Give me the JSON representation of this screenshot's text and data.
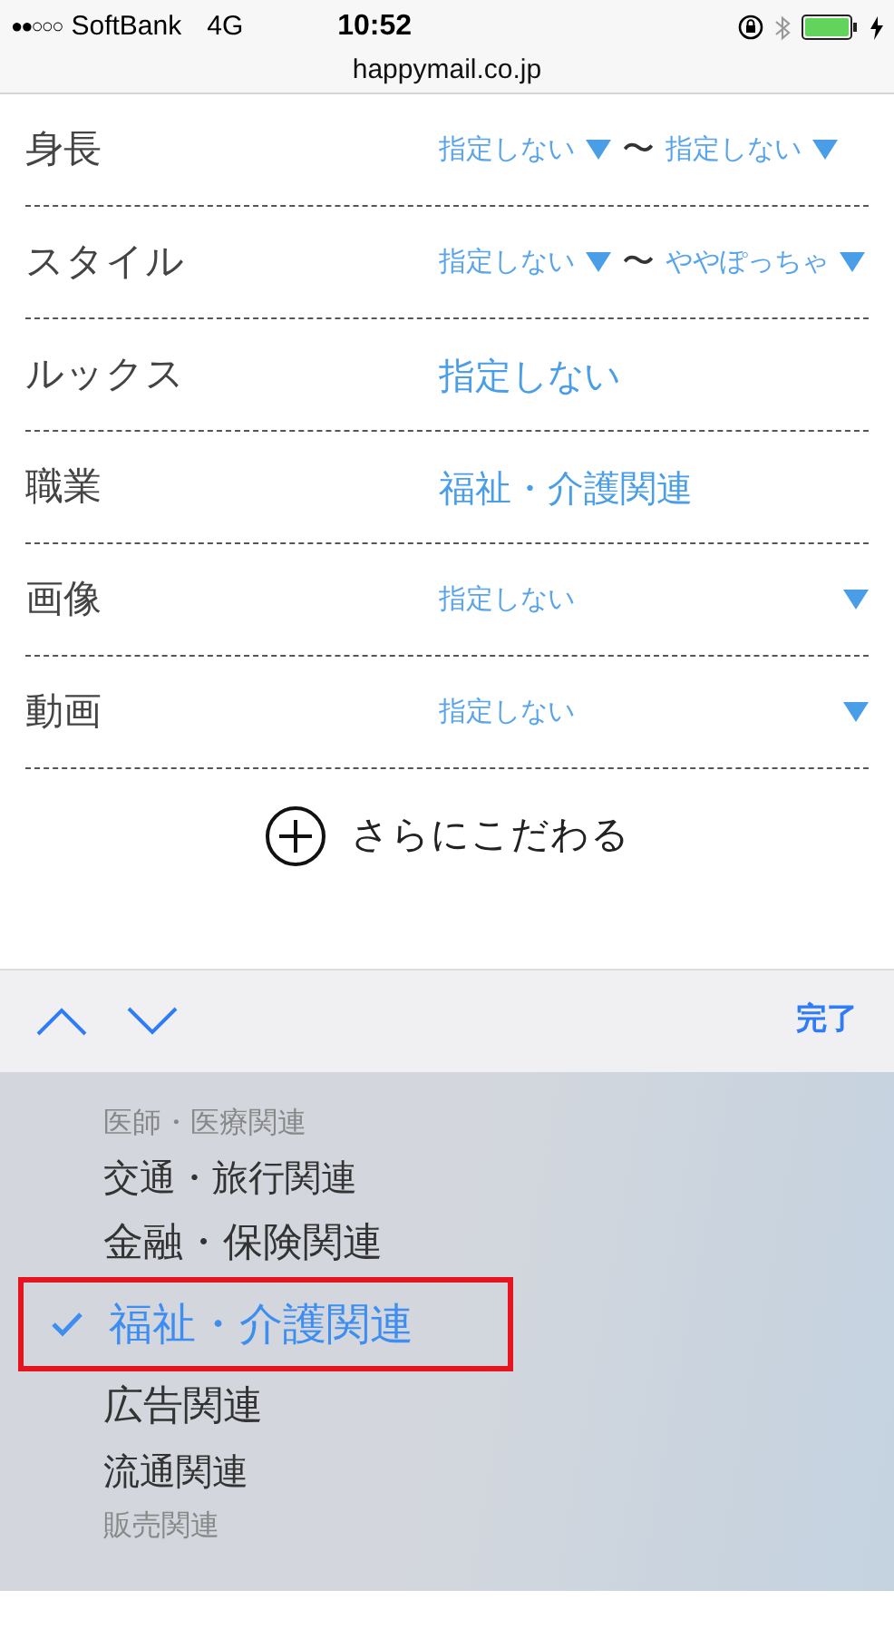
{
  "status_bar": {
    "signal_dots": "●●○○○",
    "carrier": "SoftBank",
    "network": "4G",
    "time": "10:52"
  },
  "address_bar": {
    "url": "happymail.co.jp"
  },
  "rows": [
    {
      "kind": "range",
      "label": "身長",
      "from": "指定しない",
      "separator": "〜",
      "to": "指定しない"
    },
    {
      "kind": "range",
      "label": "スタイル",
      "from": "指定しない",
      "separator": "〜",
      "to": "ややぽっちゃ"
    },
    {
      "kind": "value",
      "label": "ルックス",
      "value": "指定しない"
    },
    {
      "kind": "value",
      "label": "職業",
      "value": "福祉・介護関連"
    },
    {
      "kind": "select",
      "label": "画像",
      "value": "指定しない"
    },
    {
      "kind": "select",
      "label": "動画",
      "value": "指定しない"
    }
  ],
  "more_button": {
    "label": "さらにこだわる"
  },
  "picker_toolbar": {
    "done": "完了"
  },
  "picker": {
    "options": [
      {
        "label": "医師・医療関連",
        "selected": false,
        "highlighted": false
      },
      {
        "label": "交通・旅行関連",
        "selected": false,
        "highlighted": false
      },
      {
        "label": "金融・保険関連",
        "selected": false,
        "highlighted": false
      },
      {
        "label": "福祉・介護関連",
        "selected": true,
        "highlighted": true
      },
      {
        "label": "広告関連",
        "selected": false,
        "highlighted": false
      },
      {
        "label": "流通関連",
        "selected": false,
        "highlighted": false
      },
      {
        "label": "販売関連",
        "selected": false,
        "highlighted": false
      }
    ]
  }
}
